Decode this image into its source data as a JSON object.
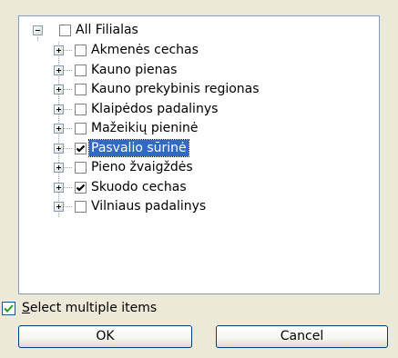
{
  "tree": {
    "root": {
      "label": "All Filialas",
      "expander": "collapse",
      "checked": false
    },
    "items": [
      {
        "label": "Akmenės cechas",
        "checked": false,
        "selected": false
      },
      {
        "label": "Kauno pienas",
        "checked": false,
        "selected": false
      },
      {
        "label": "Kauno prekybinis regionas",
        "checked": false,
        "selected": false
      },
      {
        "label": "Klaipėdos padalinys",
        "checked": false,
        "selected": false
      },
      {
        "label": "Mažeikių pieninė",
        "checked": false,
        "selected": false
      },
      {
        "label": "Pasvalio sūrinė",
        "checked": true,
        "selected": true
      },
      {
        "label": "Pieno žvaigždės",
        "checked": false,
        "selected": false
      },
      {
        "label": "Skuodo cechas",
        "checked": true,
        "selected": false
      },
      {
        "label": "Vilniaus padalinys",
        "checked": false,
        "selected": false
      }
    ]
  },
  "multi_select": {
    "label_first": "S",
    "label_rest": "elect multiple items",
    "checked": true
  },
  "buttons": {
    "ok": "OK",
    "cancel": "Cancel"
  },
  "colors": {
    "selection": "#316ac5",
    "checkmark": "#000000",
    "footer_checkmark": "#21a121",
    "border": "#7f9db9"
  }
}
